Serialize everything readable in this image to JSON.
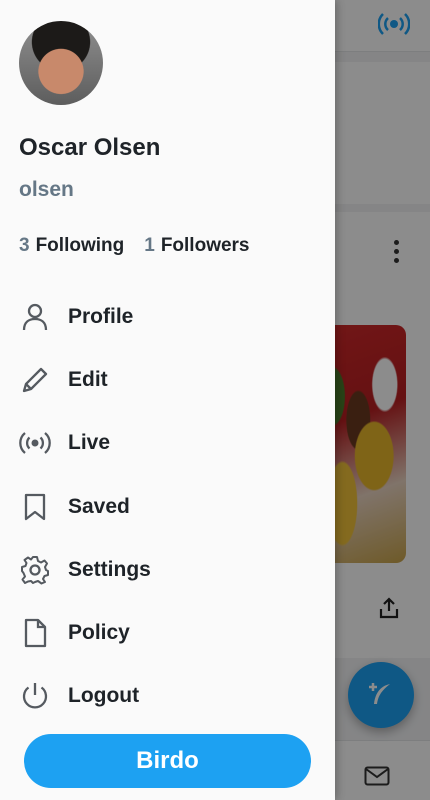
{
  "profile": {
    "name": "Oscar Olsen",
    "handle": "olsen",
    "following_count": "3",
    "following_label": "Following",
    "followers_count": "1",
    "followers_label": "Followers"
  },
  "menu": {
    "items": [
      {
        "label": "Profile",
        "icon": "person-icon"
      },
      {
        "label": "Edit",
        "icon": "pencil-icon"
      },
      {
        "label": "Live",
        "icon": "broadcast-icon"
      },
      {
        "label": "Saved",
        "icon": "bookmark-icon"
      },
      {
        "label": "Settings",
        "icon": "gear-icon"
      },
      {
        "label": "Policy",
        "icon": "document-icon"
      },
      {
        "label": "Logout",
        "icon": "power-icon"
      }
    ]
  },
  "primary_button": {
    "label": "Birdo"
  },
  "colors": {
    "accent": "#1da1f2",
    "text": "#1e2328",
    "muted": "#657786",
    "icon": "#555a60"
  }
}
